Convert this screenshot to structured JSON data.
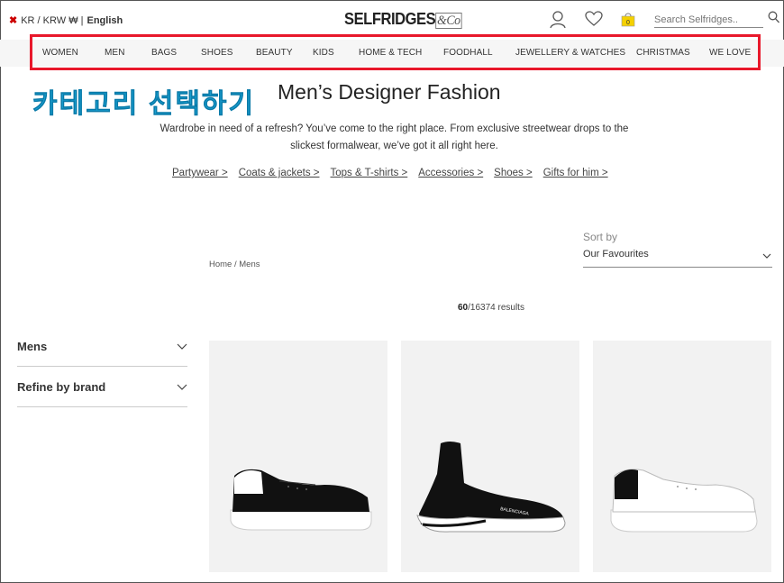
{
  "topbar": {
    "locale": "KR / KRW ₩ |",
    "language": "English",
    "logo_text": "SELFRIDGES",
    "logo_suffix": "&Co",
    "search_placeholder": "Search Selfridges..",
    "bag_count": "0",
    "icons": [
      "user-icon",
      "heart-icon",
      "bag-icon",
      "search-icon"
    ]
  },
  "nav": {
    "items": [
      "WOMEN",
      "MEN",
      "BAGS",
      "SHOES",
      "BEAUTY",
      "KIDS",
      "HOME & TECH",
      "FOODHALL",
      "JEWELLERY & WATCHES",
      "CHRISTMAS",
      "WE LOVE"
    ]
  },
  "annotation": {
    "text": "카테고리 선택하기",
    "highlight_color": "#e8182b",
    "text_color": "#1aa3d4"
  },
  "hero": {
    "title": "Men’s Designer Fashion",
    "description": "Wardrobe in need of a refresh? You’ve come to the right place. From exclusive streetwear drops to the slickest formalwear, we’ve got it all right here.",
    "links": [
      "Partywear >",
      "Coats & jackets >",
      "Tops & T-shirts >",
      "Accessories >",
      "Shoes >",
      "Gifts for him >"
    ]
  },
  "sort": {
    "label": "Sort by",
    "value": "Our Favourites"
  },
  "breadcrumb": "Home / Mens",
  "results": {
    "shown": "60",
    "total": "/16374 results"
  },
  "filters": [
    "Mens",
    "Refine by brand"
  ],
  "products": [
    {
      "name": "black-sneaker-white-heel"
    },
    {
      "name": "black-sock-trainer"
    },
    {
      "name": "white-sneaker-black-heel"
    }
  ]
}
